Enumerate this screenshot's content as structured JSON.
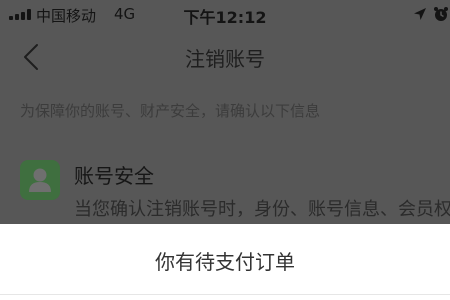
{
  "status_bar": {
    "carrier": "中国移动",
    "network": "4G",
    "time": "下午12:12"
  },
  "nav": {
    "title": "注销账号",
    "back_icon": "chevron-left-icon"
  },
  "hint": "为保障你的账号、财产安全，请确认以下信息",
  "security": {
    "icon": "user-icon",
    "title": "账号安全",
    "description": "当您确认注销账号时，身份、账号信息、会员权"
  },
  "sheet": {
    "message": "你有待支付订单"
  },
  "colors": {
    "overlay": "#575757",
    "icon_green": "#3f6f3f",
    "sheet_bg": "#ffffff"
  }
}
